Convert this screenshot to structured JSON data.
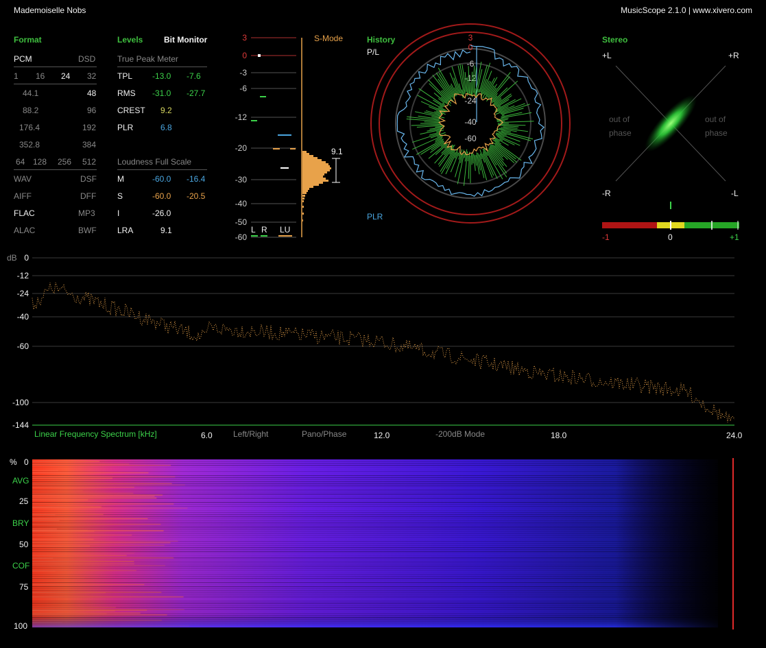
{
  "header": {
    "track_title": "Mademoiselle Nobs",
    "app_title": "MusicScope 2.1.0 | www.xivero.com"
  },
  "format": {
    "title": "Format",
    "pcm": "PCM",
    "dsd": "DSD",
    "bits": [
      "1",
      "16",
      "24",
      "32"
    ],
    "rates": [
      [
        "44.1",
        "48"
      ],
      [
        "88.2",
        "96"
      ],
      [
        "176.4",
        "192"
      ],
      [
        "352.8",
        "384"
      ]
    ],
    "dsd_rates": [
      "64",
      "128",
      "256",
      "512"
    ],
    "containers": [
      [
        "WAV",
        "DSF"
      ],
      [
        "AIFF",
        "DFF"
      ],
      [
        "FLAC",
        "MP3"
      ],
      [
        "ALAC",
        "BWF"
      ]
    ]
  },
  "levels": {
    "title": "Levels",
    "bit_monitor": "Bit Monitor",
    "true_peak_title": "True Peak Meter",
    "rows": [
      {
        "label": "TPL",
        "v1": "-13.0",
        "v2": "-7.6"
      },
      {
        "label": "RMS",
        "v1": "-31.0",
        "v2": "-27.7"
      },
      {
        "label": "CREST",
        "v1": "9.2"
      },
      {
        "label": "PLR",
        "v1": "6.8"
      }
    ],
    "loudness_title": "Loudness Full Scale",
    "loud_rows": [
      {
        "label": "M",
        "v1": "-60.0",
        "v2": "-16.4"
      },
      {
        "label": "S",
        "v1": "-60.0",
        "v2": "-20.5"
      },
      {
        "label": "I",
        "v1": "-26.0"
      },
      {
        "label": "LRA",
        "v1": "9.1"
      }
    ]
  },
  "meter": {
    "s_mode": "S-Mode",
    "scale": [
      "3",
      "0",
      "-3",
      "-6",
      "-12",
      "-20",
      "-30",
      "-40",
      "-50",
      "-60"
    ],
    "scale_values": [
      3,
      0,
      -3,
      -6,
      -12,
      -20,
      -30,
      -40,
      -50,
      -60
    ],
    "lra_value": "9.1",
    "channels": [
      "L",
      "R",
      "LU"
    ]
  },
  "history": {
    "title": "History",
    "pl_label": "P/L",
    "plr_label": "PLR",
    "ring_labels": [
      "3",
      "0",
      "-6",
      "-12",
      "-24",
      "-40",
      "-60"
    ]
  },
  "stereo": {
    "title": "Stereo",
    "corners": {
      "pl": "+L",
      "pr": "+R",
      "ml": "-R",
      "mr": "-L"
    },
    "out_of_phase": "out of phase",
    "correlation_ticks": [
      "-1",
      "0",
      "+1"
    ],
    "correlation": 0.6
  },
  "spectrum": {
    "db_label": "dB",
    "db_ticks": [
      "0",
      "-12",
      "-24",
      "-40",
      "-60",
      "-100",
      "-144"
    ],
    "title": "Linear Frequency Spectrum [kHz]",
    "x_ticks": [
      "6.0",
      "12.0",
      "18.0",
      "24.0"
    ],
    "modes": [
      "Left/Right",
      "Pano/Phase",
      "-200dB Mode"
    ]
  },
  "spectrogram": {
    "y_ticks": [
      "%",
      "0",
      "25",
      "50",
      "75",
      "100"
    ],
    "side_labels": [
      "AVG",
      "BRY",
      "COF"
    ]
  },
  "colors": {
    "green": "#3cd24a",
    "orange": "#e8a24a",
    "cyan": "#4aa6e0",
    "red": "#e03a3a",
    "header_green": "#3fbf3f"
  }
}
